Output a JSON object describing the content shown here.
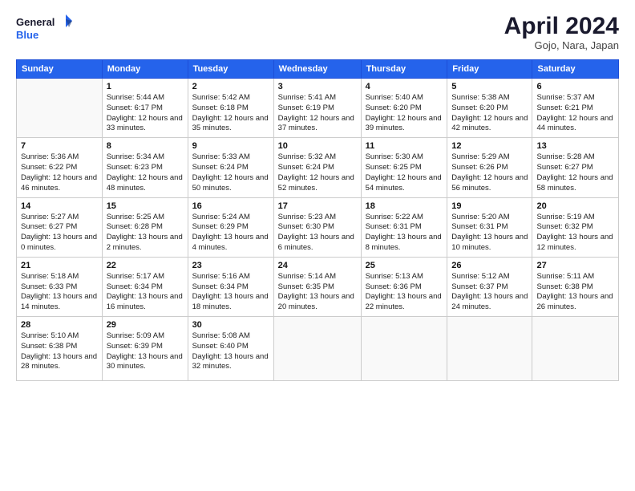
{
  "header": {
    "logo": {
      "line1": "General",
      "line2": "Blue"
    },
    "title": "April 2024",
    "subtitle": "Gojo, Nara, Japan"
  },
  "weekdays": [
    "Sunday",
    "Monday",
    "Tuesday",
    "Wednesday",
    "Thursday",
    "Friday",
    "Saturday"
  ],
  "weeks": [
    [
      {
        "day": "",
        "sunrise": "",
        "sunset": "",
        "daylight": ""
      },
      {
        "day": "1",
        "sunrise": "Sunrise: 5:44 AM",
        "sunset": "Sunset: 6:17 PM",
        "daylight": "Daylight: 12 hours and 33 minutes."
      },
      {
        "day": "2",
        "sunrise": "Sunrise: 5:42 AM",
        "sunset": "Sunset: 6:18 PM",
        "daylight": "Daylight: 12 hours and 35 minutes."
      },
      {
        "day": "3",
        "sunrise": "Sunrise: 5:41 AM",
        "sunset": "Sunset: 6:19 PM",
        "daylight": "Daylight: 12 hours and 37 minutes."
      },
      {
        "day": "4",
        "sunrise": "Sunrise: 5:40 AM",
        "sunset": "Sunset: 6:20 PM",
        "daylight": "Daylight: 12 hours and 39 minutes."
      },
      {
        "day": "5",
        "sunrise": "Sunrise: 5:38 AM",
        "sunset": "Sunset: 6:20 PM",
        "daylight": "Daylight: 12 hours and 42 minutes."
      },
      {
        "day": "6",
        "sunrise": "Sunrise: 5:37 AM",
        "sunset": "Sunset: 6:21 PM",
        "daylight": "Daylight: 12 hours and 44 minutes."
      }
    ],
    [
      {
        "day": "7",
        "sunrise": "Sunrise: 5:36 AM",
        "sunset": "Sunset: 6:22 PM",
        "daylight": "Daylight: 12 hours and 46 minutes."
      },
      {
        "day": "8",
        "sunrise": "Sunrise: 5:34 AM",
        "sunset": "Sunset: 6:23 PM",
        "daylight": "Daylight: 12 hours and 48 minutes."
      },
      {
        "day": "9",
        "sunrise": "Sunrise: 5:33 AM",
        "sunset": "Sunset: 6:24 PM",
        "daylight": "Daylight: 12 hours and 50 minutes."
      },
      {
        "day": "10",
        "sunrise": "Sunrise: 5:32 AM",
        "sunset": "Sunset: 6:24 PM",
        "daylight": "Daylight: 12 hours and 52 minutes."
      },
      {
        "day": "11",
        "sunrise": "Sunrise: 5:30 AM",
        "sunset": "Sunset: 6:25 PM",
        "daylight": "Daylight: 12 hours and 54 minutes."
      },
      {
        "day": "12",
        "sunrise": "Sunrise: 5:29 AM",
        "sunset": "Sunset: 6:26 PM",
        "daylight": "Daylight: 12 hours and 56 minutes."
      },
      {
        "day": "13",
        "sunrise": "Sunrise: 5:28 AM",
        "sunset": "Sunset: 6:27 PM",
        "daylight": "Daylight: 12 hours and 58 minutes."
      }
    ],
    [
      {
        "day": "14",
        "sunrise": "Sunrise: 5:27 AM",
        "sunset": "Sunset: 6:27 PM",
        "daylight": "Daylight: 13 hours and 0 minutes."
      },
      {
        "day": "15",
        "sunrise": "Sunrise: 5:25 AM",
        "sunset": "Sunset: 6:28 PM",
        "daylight": "Daylight: 13 hours and 2 minutes."
      },
      {
        "day": "16",
        "sunrise": "Sunrise: 5:24 AM",
        "sunset": "Sunset: 6:29 PM",
        "daylight": "Daylight: 13 hours and 4 minutes."
      },
      {
        "day": "17",
        "sunrise": "Sunrise: 5:23 AM",
        "sunset": "Sunset: 6:30 PM",
        "daylight": "Daylight: 13 hours and 6 minutes."
      },
      {
        "day": "18",
        "sunrise": "Sunrise: 5:22 AM",
        "sunset": "Sunset: 6:31 PM",
        "daylight": "Daylight: 13 hours and 8 minutes."
      },
      {
        "day": "19",
        "sunrise": "Sunrise: 5:20 AM",
        "sunset": "Sunset: 6:31 PM",
        "daylight": "Daylight: 13 hours and 10 minutes."
      },
      {
        "day": "20",
        "sunrise": "Sunrise: 5:19 AM",
        "sunset": "Sunset: 6:32 PM",
        "daylight": "Daylight: 13 hours and 12 minutes."
      }
    ],
    [
      {
        "day": "21",
        "sunrise": "Sunrise: 5:18 AM",
        "sunset": "Sunset: 6:33 PM",
        "daylight": "Daylight: 13 hours and 14 minutes."
      },
      {
        "day": "22",
        "sunrise": "Sunrise: 5:17 AM",
        "sunset": "Sunset: 6:34 PM",
        "daylight": "Daylight: 13 hours and 16 minutes."
      },
      {
        "day": "23",
        "sunrise": "Sunrise: 5:16 AM",
        "sunset": "Sunset: 6:34 PM",
        "daylight": "Daylight: 13 hours and 18 minutes."
      },
      {
        "day": "24",
        "sunrise": "Sunrise: 5:14 AM",
        "sunset": "Sunset: 6:35 PM",
        "daylight": "Daylight: 13 hours and 20 minutes."
      },
      {
        "day": "25",
        "sunrise": "Sunrise: 5:13 AM",
        "sunset": "Sunset: 6:36 PM",
        "daylight": "Daylight: 13 hours and 22 minutes."
      },
      {
        "day": "26",
        "sunrise": "Sunrise: 5:12 AM",
        "sunset": "Sunset: 6:37 PM",
        "daylight": "Daylight: 13 hours and 24 minutes."
      },
      {
        "day": "27",
        "sunrise": "Sunrise: 5:11 AM",
        "sunset": "Sunset: 6:38 PM",
        "daylight": "Daylight: 13 hours and 26 minutes."
      }
    ],
    [
      {
        "day": "28",
        "sunrise": "Sunrise: 5:10 AM",
        "sunset": "Sunset: 6:38 PM",
        "daylight": "Daylight: 13 hours and 28 minutes."
      },
      {
        "day": "29",
        "sunrise": "Sunrise: 5:09 AM",
        "sunset": "Sunset: 6:39 PM",
        "daylight": "Daylight: 13 hours and 30 minutes."
      },
      {
        "day": "30",
        "sunrise": "Sunrise: 5:08 AM",
        "sunset": "Sunset: 6:40 PM",
        "daylight": "Daylight: 13 hours and 32 minutes."
      },
      {
        "day": "",
        "sunrise": "",
        "sunset": "",
        "daylight": ""
      },
      {
        "day": "",
        "sunrise": "",
        "sunset": "",
        "daylight": ""
      },
      {
        "day": "",
        "sunrise": "",
        "sunset": "",
        "daylight": ""
      },
      {
        "day": "",
        "sunrise": "",
        "sunset": "",
        "daylight": ""
      }
    ]
  ]
}
